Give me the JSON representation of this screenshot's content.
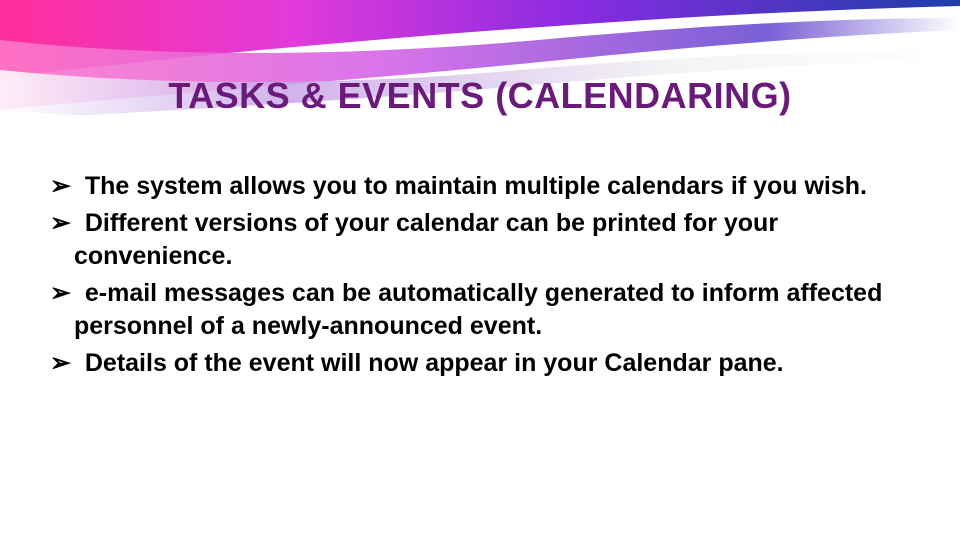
{
  "slide": {
    "title": "TASKS & EVENTS (CALENDARING)",
    "bullet_marker": "➢",
    "bullets": [
      "The system allows you to maintain multiple calendars if you wish.",
      "Different versions of your calendar can be printed for your convenience.",
      "e-mail messages can be automatically generated to inform affected personnel of a newly-announced event.",
      "Details of the event will now appear in your Calendar pane."
    ]
  },
  "theme": {
    "title_color": "#6a1b7a",
    "body_color": "#000000"
  }
}
